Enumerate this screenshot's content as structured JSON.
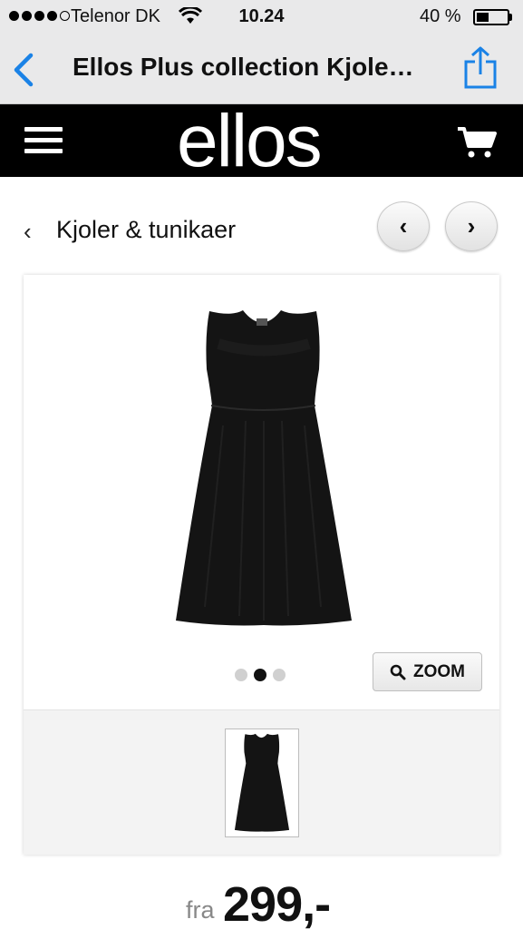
{
  "status_bar": {
    "carrier": "Telenor DK",
    "time": "10.24",
    "battery_percent": "40 %",
    "battery_level": 0.4,
    "signal_bars": 4,
    "signal_max": 5
  },
  "nav": {
    "title": "Ellos Plus collection Kjole…",
    "back_icon": "chevron-left-icon",
    "share_icon": "share-icon",
    "accent_color": "#1a82e6"
  },
  "header": {
    "brand": "ellos",
    "menu_icon": "hamburger-icon",
    "cart_icon": "cart-icon"
  },
  "breadcrumb": {
    "chevron": "‹",
    "label": "Kjoler & tunikaer",
    "prev": "‹",
    "next": "›"
  },
  "gallery": {
    "image_count": 3,
    "active_index": 1,
    "zoom_label": "ZOOM",
    "zoom_icon": "search-icon"
  },
  "price": {
    "prefix": "fra",
    "amount": "299,-"
  }
}
